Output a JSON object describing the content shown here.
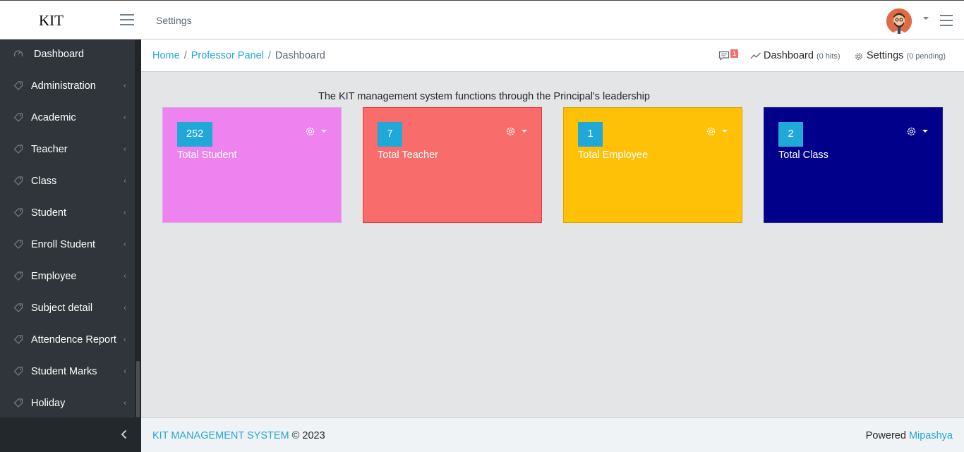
{
  "header": {
    "brand": "KIT",
    "settings_label": "Settings"
  },
  "sidebar": {
    "items": [
      {
        "label": "Dashboard",
        "icon": "speedometer-icon"
      },
      {
        "label": "Administration",
        "icon": "tag-icon"
      },
      {
        "label": "Academic",
        "icon": "tag-icon"
      },
      {
        "label": "Teacher",
        "icon": "tag-icon"
      },
      {
        "label": "Class",
        "icon": "tag-icon"
      },
      {
        "label": "Student",
        "icon": "tag-icon"
      },
      {
        "label": "Enroll Student",
        "icon": "tag-icon"
      },
      {
        "label": "Employee",
        "icon": "tag-icon"
      },
      {
        "label": "Subject detail",
        "icon": "tag-icon"
      },
      {
        "label": "Attendence Report",
        "icon": "tag-icon"
      },
      {
        "label": "Student Marks",
        "icon": "tag-icon"
      },
      {
        "label": "Holiday",
        "icon": "tag-icon"
      }
    ]
  },
  "breadcrumb": {
    "items": [
      "Home",
      "Professor Panel",
      "Dashboard"
    ],
    "messages_badge": "1",
    "dashboard_label": "Dashboard",
    "dashboard_hits": "(0 hits)",
    "settings_label": "Settings",
    "settings_pending": "(0 pending)"
  },
  "main": {
    "subtitle": "The KIT management system functions through the Principal's leadership",
    "cards": [
      {
        "value": "252",
        "label": "Total Student",
        "color": "#ee82ee"
      },
      {
        "value": "7",
        "label": "Total Teacher",
        "color": "#f86c6b"
      },
      {
        "value": "1",
        "label": "Total Employee",
        "color": "#ffc107"
      },
      {
        "value": "2",
        "label": "Total Class",
        "color": "#00008b"
      }
    ]
  },
  "footer": {
    "brand": "KIT MANAGEMENT SYSTEM",
    "copyright": "© 2023",
    "powered_label": "Powered",
    "powered_by": "Mipashya"
  },
  "colors": {
    "accent": "#20a8d8",
    "sidebar_bg": "#2f353a",
    "badge": "#f86c6b"
  }
}
